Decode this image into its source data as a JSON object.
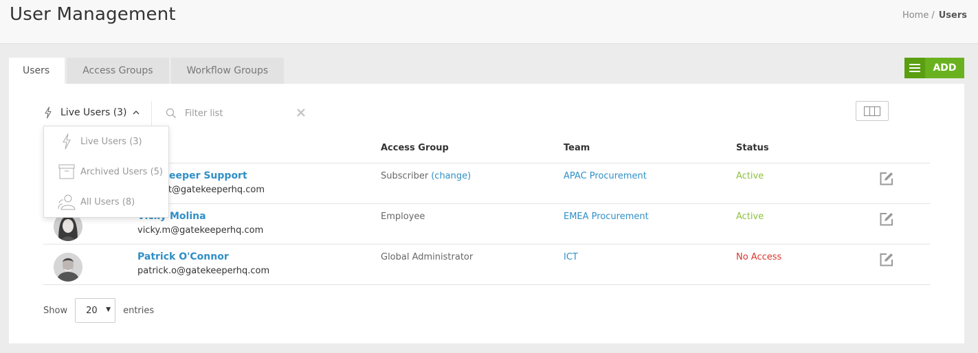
{
  "header": {
    "title": "User Management",
    "breadcrumb": {
      "home": "Home",
      "separator": "/",
      "current": "Users"
    }
  },
  "tabs": [
    {
      "label": "Users",
      "active": true
    },
    {
      "label": "Access Groups",
      "active": false
    },
    {
      "label": "Workflow Groups",
      "active": false
    }
  ],
  "toolbar": {
    "add_label": "ADD",
    "add_menu_icon": "hamburger-icon",
    "columns_icon": "columns-icon",
    "accent_color": "#6ab11f"
  },
  "filter": {
    "selected_label": "Live Users (3)",
    "caret": "^",
    "search_placeholder": "Filter list",
    "clear_symbol": "✕"
  },
  "dropdown": {
    "items": [
      {
        "label": "Live Users (3)",
        "icon": "bolt-icon"
      },
      {
        "label": "Archived Users (5)",
        "icon": "archive-box-icon"
      },
      {
        "label": "All Users (8)",
        "icon": "users-icon"
      }
    ]
  },
  "table": {
    "columns": [
      "Access Group",
      "Team",
      "Status"
    ],
    "rows": [
      {
        "name": "Gatekeeper Support",
        "email": "support@gatekeeperhq.com",
        "access_group": "Subscriber",
        "access_change": "(change)",
        "team": "APAC Procurement",
        "status": "Active",
        "status_color": "#8dc03e"
      },
      {
        "name": "Vicky Molina",
        "email": "vicky.m@gatekeeperhq.com",
        "access_group": "Employee",
        "access_change": "",
        "team": "EMEA Procurement",
        "status": "Active",
        "status_color": "#8dc03e"
      },
      {
        "name": "Patrick O'Connor",
        "email": "patrick.o@gatekeeperhq.com",
        "access_group": "Global Administrator",
        "access_change": "",
        "team": "ICT",
        "status": "No Access",
        "status_color": "#d9342b"
      }
    ]
  },
  "pagination": {
    "show_label": "Show",
    "entries_value": "20",
    "entries_label": "entries"
  }
}
